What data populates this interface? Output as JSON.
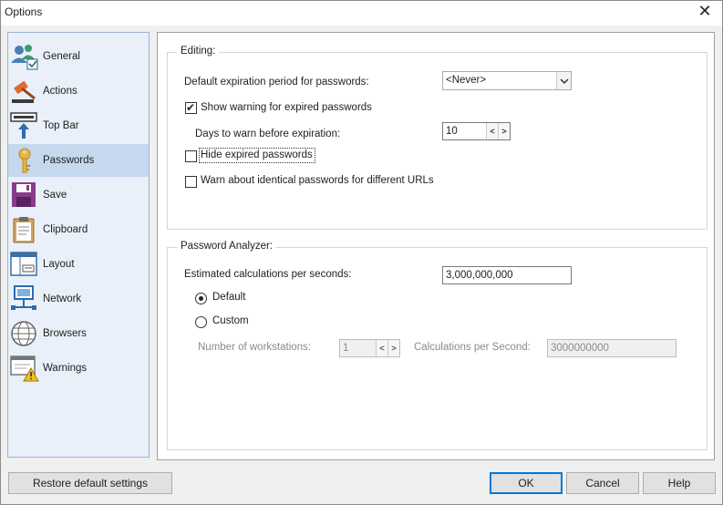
{
  "window": {
    "title": "Options"
  },
  "sidebar": {
    "items": [
      {
        "label": "General",
        "icon": "users-check-icon",
        "selected": false
      },
      {
        "label": "Actions",
        "icon": "gavel-icon",
        "selected": false
      },
      {
        "label": "Top Bar",
        "icon": "top-bar-arrow-icon",
        "selected": false
      },
      {
        "label": "Passwords",
        "icon": "key-icon",
        "selected": true
      },
      {
        "label": "Save",
        "icon": "floppy-disk-icon",
        "selected": false
      },
      {
        "label": "Clipboard",
        "icon": "clipboard-icon",
        "selected": false
      },
      {
        "label": "Layout",
        "icon": "layout-window-icon",
        "selected": false
      },
      {
        "label": "Network",
        "icon": "network-computer-icon",
        "selected": false
      },
      {
        "label": "Browsers",
        "icon": "globe-icon",
        "selected": false
      },
      {
        "label": "Warnings",
        "icon": "warning-window-icon",
        "selected": false
      }
    ]
  },
  "editing": {
    "group_title": "Editing:",
    "expiration_label": "Default expiration period for passwords:",
    "expiration_value": "<Never>",
    "show_warning_label": "Show warning for expired passwords",
    "show_warning_checked": true,
    "days_label": "Days to warn before expiration:",
    "days_value": "10",
    "hide_expired_label": "Hide expired passwords",
    "hide_expired_checked": false,
    "warn_identical_label": "Warn about identical passwords for different URLs",
    "warn_identical_checked": false
  },
  "analyzer": {
    "group_title": "Password Analyzer:",
    "calc_label": "Estimated calculations per seconds:",
    "calc_value": "3,000,000,000",
    "default_label": "Default",
    "default_selected": true,
    "custom_label": "Custom",
    "custom_selected": false,
    "workstations_label": "Number of workstations:",
    "workstations_value": "1",
    "cps_label": "Calculations per Second:",
    "cps_value": "3000000000"
  },
  "footer": {
    "restore_label": "Restore default settings",
    "ok_label": "OK",
    "cancel_label": "Cancel",
    "help_label": "Help"
  },
  "glyphs": {
    "close": "✕",
    "check": "✔",
    "spin_left": "<",
    "spin_right": ">"
  },
  "colors": {
    "selection": "#c6d8ee",
    "sidebar_bg": "#e9f0f9",
    "default_button_border": "#0078d7"
  }
}
